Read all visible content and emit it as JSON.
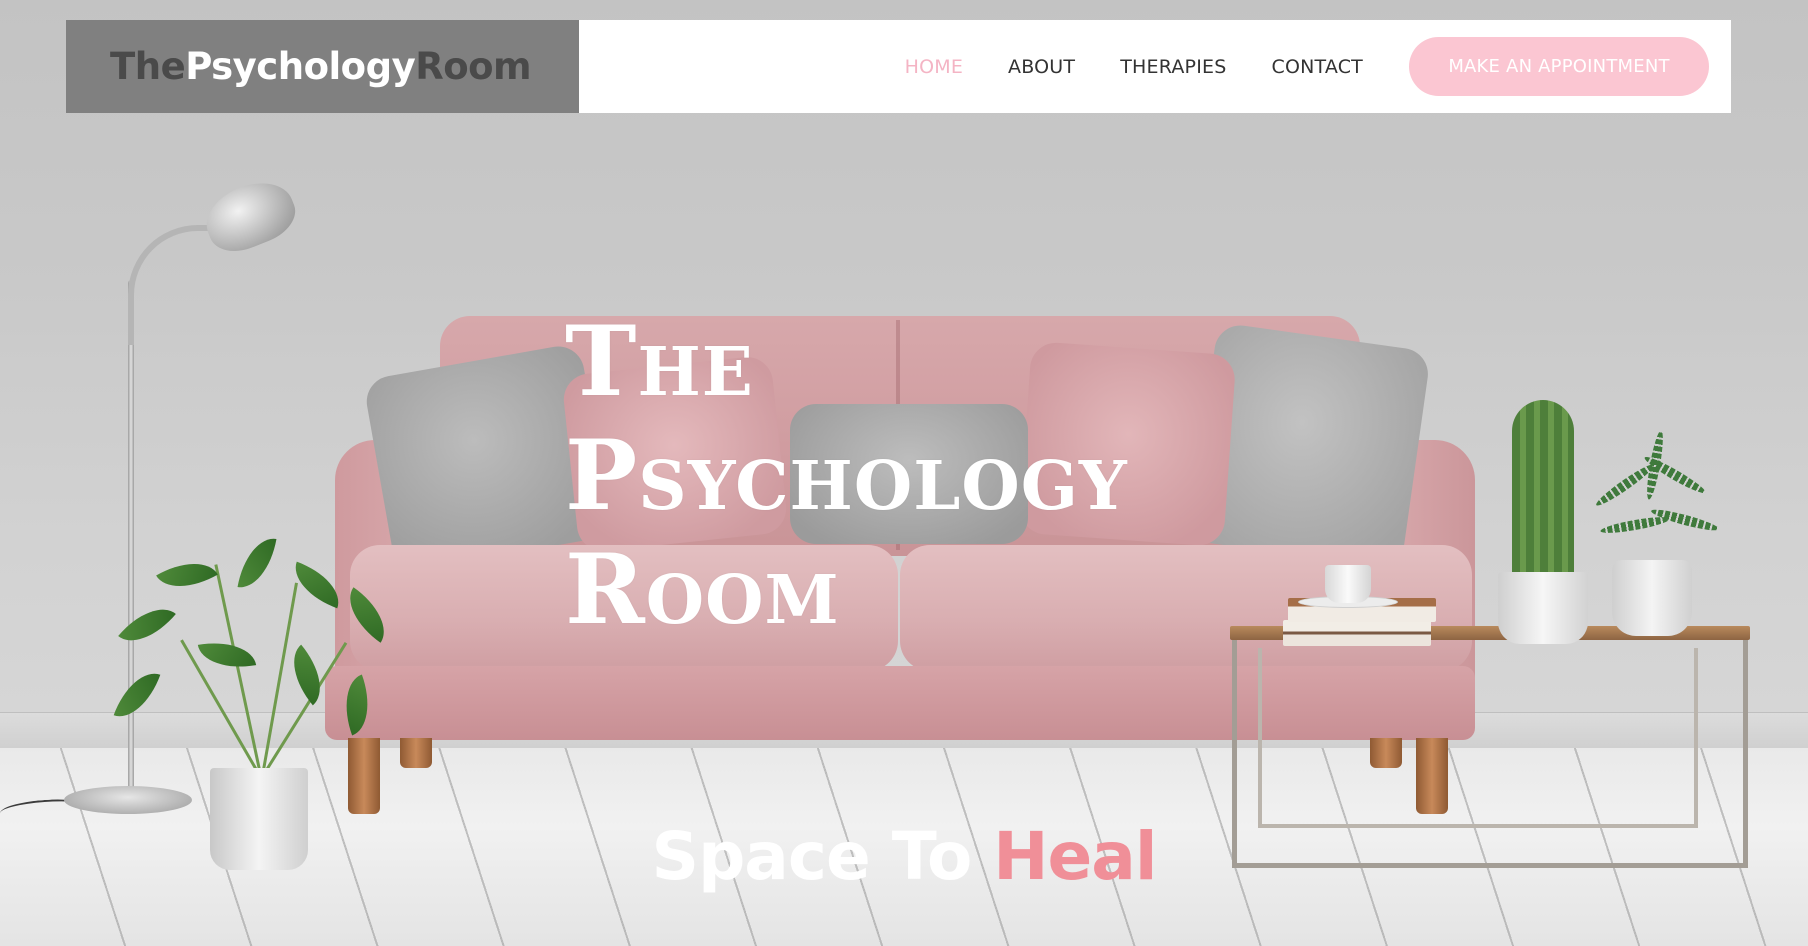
{
  "brand": {
    "logo_part1": "The",
    "logo_part2": "Psychology",
    "logo_part3": "Room"
  },
  "nav": {
    "items": [
      {
        "label": "HOME",
        "active": true
      },
      {
        "label": "ABOUT",
        "active": false
      },
      {
        "label": "THERAPIES",
        "active": false
      },
      {
        "label": "CONTACT",
        "active": false
      }
    ],
    "cta_label": "MAKE AN APPOINTMENT"
  },
  "hero": {
    "title_lines": [
      "The",
      "Psychology",
      "Room"
    ],
    "tagline_part1": "Space To ",
    "tagline_part2": "Heal"
  },
  "colors": {
    "logo_bg": "#808080",
    "nav_bg": "#ffffff",
    "nav_active": "#f4b4c4",
    "cta_bg": "#fbc6d2",
    "tagline_accent": "#f08f98"
  },
  "icons": {
    "background_image": "living-room-with-pink-sofa"
  }
}
